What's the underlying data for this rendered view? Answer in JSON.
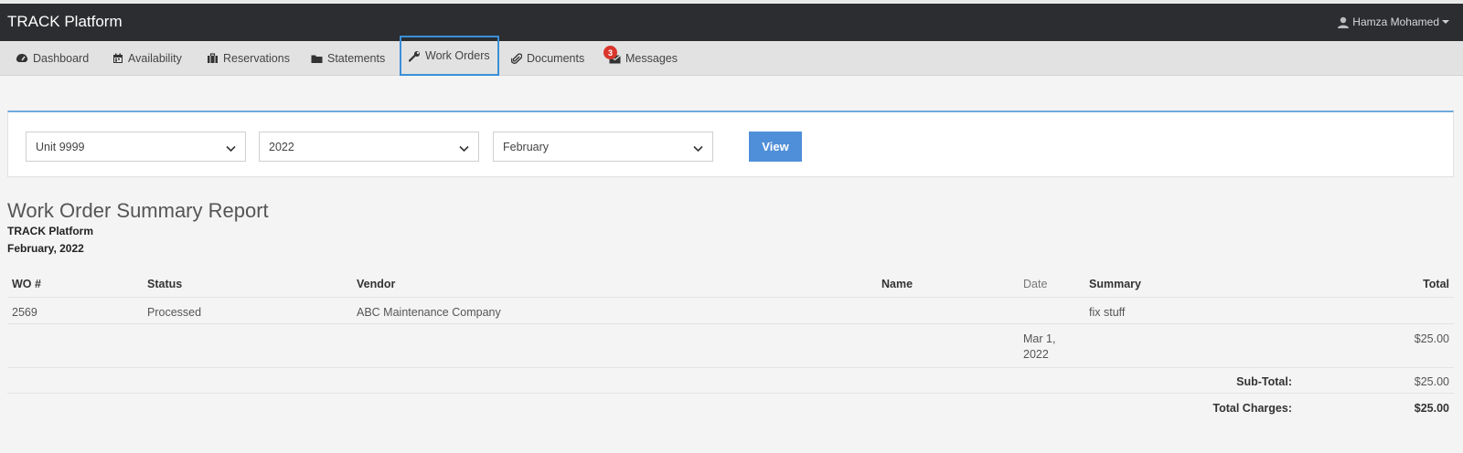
{
  "app": {
    "brand": "TRACK Platform",
    "user_name": "Hamza Mohamed",
    "accent_color": "#3a8fd8"
  },
  "nav": {
    "items": [
      {
        "label": "Dashboard",
        "icon": "dashboard-icon"
      },
      {
        "label": "Availability",
        "icon": "calendar-icon"
      },
      {
        "label": "Reservations",
        "icon": "suitcase-icon"
      },
      {
        "label": "Statements",
        "icon": "folder-icon"
      },
      {
        "label": "Work Orders",
        "icon": "wrench-icon",
        "active": true
      },
      {
        "label": "Documents",
        "icon": "paperclip-icon"
      },
      {
        "label": "Messages",
        "icon": "envelope-icon",
        "badge": "3"
      }
    ]
  },
  "filters": {
    "unit": "Unit 9999",
    "year": "2022",
    "month": "February",
    "view_label": "View"
  },
  "report": {
    "title": "Work Order Summary Report",
    "company": "TRACK Platform",
    "period": "February, 2022",
    "columns": [
      "WO #",
      "Status",
      "Vendor",
      "Name",
      "Date",
      "Summary",
      "Total"
    ],
    "rows": [
      {
        "wo": "2569",
        "status": "Processed",
        "vendor": "ABC Maintenance Company",
        "name": "",
        "date": "",
        "summary": "fix stuff",
        "total": ""
      }
    ],
    "charge": {
      "date_line1": "Mar 1,",
      "date_line2": "2022",
      "amount": "$25.00"
    },
    "subtotal_label": "Sub-Total:",
    "subtotal_value": "$25.00",
    "total_label": "Total Charges:",
    "total_value": "$25.00"
  }
}
